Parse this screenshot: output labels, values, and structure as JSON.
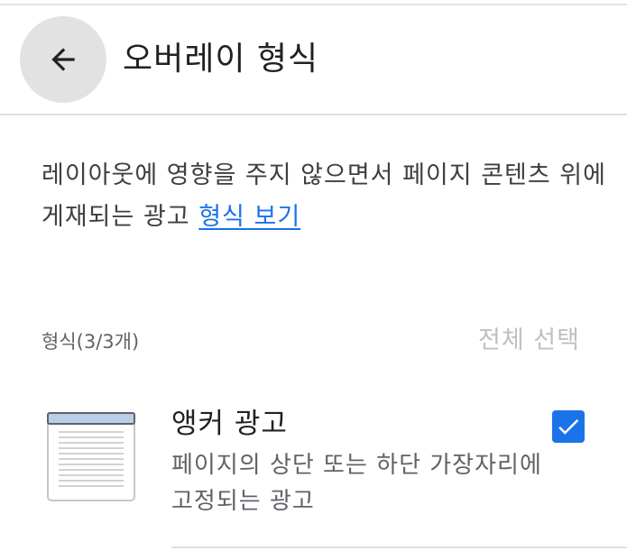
{
  "header": {
    "title": "오버레이 형식",
    "back_icon": "arrow-back-icon"
  },
  "description": {
    "text": "레이아웃에 영향을 주지 않으면서 페이지 콘텐츠 위에 게재되는 광고 ",
    "link_label": "형식 보기"
  },
  "formats": {
    "label": "형식(3/3개)",
    "select_all_label": "전체 선택",
    "items": [
      {
        "title": "앵커 광고",
        "description": "페이지의 상단 또는 하단 가장자리에 고정되는 광고",
        "checked": true,
        "icon": "anchor-ad-icon"
      }
    ]
  },
  "colors": {
    "accent": "#1a73e8",
    "back_button_bg": "#e2e2e2",
    "disabled_text": "#c0c0c0"
  }
}
